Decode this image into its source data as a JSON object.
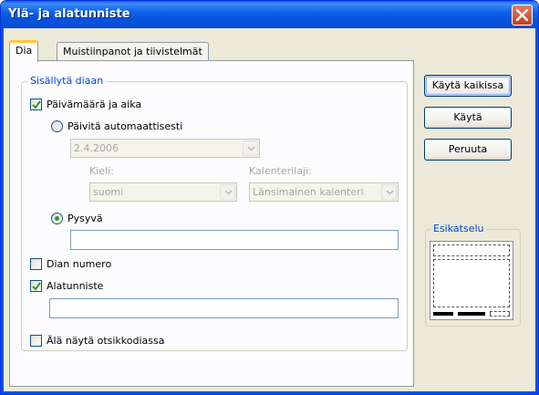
{
  "window": {
    "title": "Ylä- ja alatunniste"
  },
  "tabs": [
    {
      "label": "Dia",
      "active": true
    },
    {
      "label": "Muistiinpanot ja tiivistelmät",
      "active": false
    }
  ],
  "include_group": {
    "label": "Sisällytä diaan",
    "date_time": {
      "label": "Päivämäärä ja aika",
      "checked": true
    },
    "auto_update": {
      "label": "Päivitä automaattisesti",
      "selected": false
    },
    "date_format": {
      "value": "2.4.2006"
    },
    "language": {
      "label": "Kieli:",
      "value": "suomi"
    },
    "calendar": {
      "label": "Kalenterilaji:",
      "value": "Länsimainen kalenteri"
    },
    "fixed": {
      "label": "Pysyvä",
      "selected": true,
      "value": ""
    },
    "slide_number": {
      "label": "Dian numero",
      "checked": false
    },
    "footer": {
      "label": "Alatunniste",
      "checked": true,
      "value": ""
    }
  },
  "hide_on_title": {
    "label": "Älä näytä otsikkodiassa",
    "checked": false
  },
  "buttons": {
    "apply_all": "Käytä kaikissa",
    "apply": "Käytä",
    "cancel": "Peruuta"
  },
  "preview": {
    "label": "Esikatselu"
  },
  "colors": {
    "titlebar": "#0a5fe6",
    "accent_text": "#0046d5",
    "frame": "#ece9d8"
  }
}
